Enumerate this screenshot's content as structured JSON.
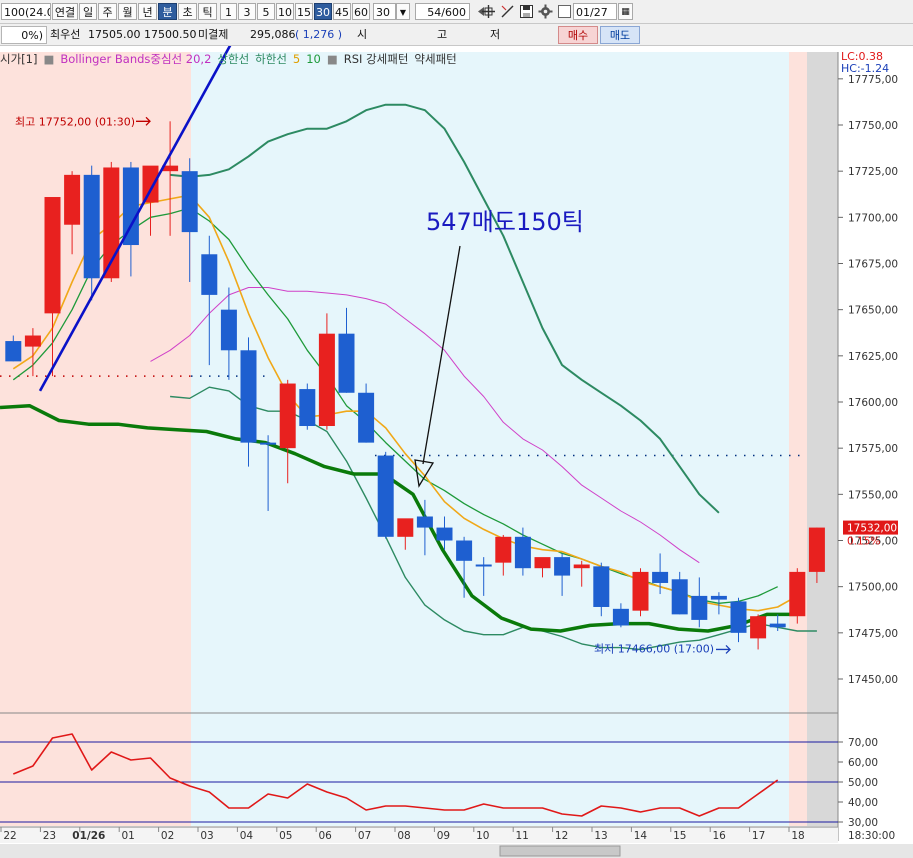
{
  "toolbar": {
    "code_field": "100(24.0",
    "periods": [
      "연결",
      "일",
      "주",
      "월",
      "년",
      "분",
      "초",
      "틱"
    ],
    "active_period": "분",
    "intervals": [
      "1",
      "3",
      "5",
      "10",
      "15",
      "30",
      "45",
      "60"
    ],
    "active_interval": "30",
    "interval_select": "30",
    "count_field": "54/600",
    "date_field": "01/27"
  },
  "quote_bar": {
    "pct": "0%)",
    "best_bid_label": "최우선",
    "best_bid_values": "17505.00  17500.50",
    "open_interest_label": "미결제",
    "open_interest_value": "295,086",
    "open_interest_change": "( 1,276 )",
    "col_open": "시",
    "col_high": "고",
    "col_low": "저",
    "buy_button": "매수",
    "sell_button": "매도"
  },
  "legend": {
    "series": "시가[1]",
    "bollinger_mid": "Bollinger Bands중심선 20,2",
    "bollinger_upper": "상한선",
    "bollinger_lower": "하한선",
    "ma1": "5",
    "ma2": "10",
    "rsi_strong": "RSI 강세패턴",
    "rsi_weak": "약세패턴",
    "lc": "LC:0.38",
    "hc": "HC:-1.24"
  },
  "colors": {
    "bull": "#e8211f",
    "bear": "#1e5fd0",
    "bg_pre_session": "#fde2dc",
    "bg_session": "#e6f6fb",
    "bb_upper_lower": "#2d8a62",
    "ma5": "#f0a818",
    "ma10": "#1e9a3a",
    "bb_mid": "#d040c8",
    "ichimoku_thick": "#0a7a0a",
    "rsi_line": "#e01818",
    "trend_line": "#0a12c8",
    "annotation": "#1a1ac0"
  },
  "chart_data": {
    "type": "candlestick",
    "interval_minutes": 30,
    "ylim": [
      17430,
      17785
    ],
    "price_axis_ticks": [
      "17775,00",
      "17750,00",
      "17725,00",
      "17700,00",
      "17675,00",
      "17650,00",
      "17625,00",
      "17600,00",
      "17575,00",
      "17550,00",
      "17525,00",
      "17500,00",
      "17475,00",
      "17450,00"
    ],
    "price_tick_values": [
      17775,
      17750,
      17725,
      17700,
      17675,
      17650,
      17625,
      17600,
      17575,
      17550,
      17525,
      17500,
      17475,
      17450
    ],
    "time_axis_labels": [
      "22",
      "23",
      "01/26",
      "01",
      "02",
      "03",
      "04",
      "05",
      "06",
      "07",
      "08",
      "09",
      "10",
      "11",
      "12",
      "13",
      "14",
      "15",
      "16",
      "17",
      "18"
    ],
    "last_price_label": "17532,00",
    "last_change_label": "0.15%",
    "high_annotation": "최고 17752,00 (01:30)",
    "low_annotation": "최저 17466,00 (17:00)",
    "custom_annotation": "547매도150틱",
    "candles": [
      {
        "o": 17633,
        "h": 17636,
        "l": 17622,
        "c": 17622
      },
      {
        "o": 17630,
        "h": 17640,
        "l": 17614,
        "c": 17636
      },
      {
        "o": 17648,
        "h": 17660,
        "l": 17614,
        "c": 17711
      },
      {
        "o": 17696,
        "h": 17725,
        "l": 17680,
        "c": 17723
      },
      {
        "o": 17723,
        "h": 17728,
        "l": 17655,
        "c": 17667
      },
      {
        "o": 17667,
        "h": 17730,
        "l": 17665,
        "c": 17727
      },
      {
        "o": 17727,
        "h": 17730,
        "l": 17668,
        "c": 17685
      },
      {
        "o": 17708,
        "h": 17715,
        "l": 17690,
        "c": 17728
      },
      {
        "o": 17725,
        "h": 17752,
        "l": 17690,
        "c": 17728
      },
      {
        "o": 17725,
        "h": 17732,
        "l": 17665,
        "c": 17692
      },
      {
        "o": 17680,
        "h": 17690,
        "l": 17620,
        "c": 17658
      },
      {
        "o": 17650,
        "h": 17662,
        "l": 17612,
        "c": 17628
      },
      {
        "o": 17628,
        "h": 17635,
        "l": 17565,
        "c": 17578
      },
      {
        "o": 17578,
        "h": 17582,
        "l": 17541,
        "c": 17577
      },
      {
        "o": 17575,
        "h": 17612,
        "l": 17556,
        "c": 17610
      },
      {
        "o": 17607,
        "h": 17610,
        "l": 17585,
        "c": 17587
      },
      {
        "o": 17587,
        "h": 17648,
        "l": 17585,
        "c": 17637
      },
      {
        "o": 17637,
        "h": 17651,
        "l": 17605,
        "c": 17605
      },
      {
        "o": 17605,
        "h": 17610,
        "l": 17578,
        "c": 17578
      },
      {
        "o": 17571,
        "h": 17573,
        "l": 17526,
        "c": 17527
      },
      {
        "o": 17527,
        "h": 17535,
        "l": 17520,
        "c": 17537
      },
      {
        "o": 17538,
        "h": 17547,
        "l": 17517,
        "c": 17532
      },
      {
        "o": 17532,
        "h": 17538,
        "l": 17520,
        "c": 17525
      },
      {
        "o": 17525,
        "h": 17527,
        "l": 17494,
        "c": 17514
      },
      {
        "o": 17512,
        "h": 17516,
        "l": 17495,
        "c": 17511
      },
      {
        "o": 17513,
        "h": 17528,
        "l": 17506,
        "c": 17527
      },
      {
        "o": 17527,
        "h": 17532,
        "l": 17506,
        "c": 17510
      },
      {
        "o": 17510,
        "h": 17515,
        "l": 17505,
        "c": 17516
      },
      {
        "o": 17516,
        "h": 17518,
        "l": 17495,
        "c": 17506
      },
      {
        "o": 17510,
        "h": 17514,
        "l": 17500,
        "c": 17512
      },
      {
        "o": 17511,
        "h": 17513,
        "l": 17484,
        "c": 17489
      },
      {
        "o": 17488,
        "h": 17491,
        "l": 17478,
        "c": 17479
      },
      {
        "o": 17487,
        "h": 17510,
        "l": 17484,
        "c": 17508
      },
      {
        "o": 17508,
        "h": 17518,
        "l": 17496,
        "c": 17502
      },
      {
        "o": 17504,
        "h": 17508,
        "l": 17485,
        "c": 17485
      },
      {
        "o": 17495,
        "h": 17505,
        "l": 17478,
        "c": 17482
      },
      {
        "o": 17495,
        "h": 17497,
        "l": 17485,
        "c": 17493
      },
      {
        "o": 17492,
        "h": 17494,
        "l": 17470,
        "c": 17475
      },
      {
        "o": 17472,
        "h": 17485,
        "l": 17466,
        "c": 17484
      },
      {
        "o": 17480,
        "h": 17485,
        "l": 17476,
        "c": 17478
      },
      {
        "o": 17484,
        "h": 17510,
        "l": 17480,
        "c": 17508
      },
      {
        "o": 17508,
        "h": 17532,
        "l": 17502,
        "c": 17532
      }
    ],
    "bb_upper": [
      null,
      null,
      null,
      null,
      null,
      null,
      null,
      null,
      17723,
      17722,
      17723,
      17726,
      17733,
      17741,
      17745,
      17748,
      17748,
      17752,
      17758,
      17761,
      17761,
      17758,
      17748,
      17730,
      17710,
      17690,
      17665,
      17640,
      17620,
      17612,
      17605,
      17598,
      17590,
      17580,
      17565,
      17550,
      17540
    ],
    "bb_lower": [
      null,
      null,
      null,
      null,
      null,
      null,
      null,
      null,
      17603,
      17602,
      17608,
      17606,
      17598,
      17595,
      17595,
      17590,
      17584,
      17568,
      17548,
      17527,
      17505,
      17490,
      17482,
      17476,
      17474,
      17474,
      17478,
      17476,
      17473,
      17469,
      17467,
      17467,
      17466,
      17468,
      17470,
      17471,
      17474,
      17477,
      17480,
      17478,
      17476,
      17476
    ],
    "bb_mid": [
      17622,
      17628,
      17636,
      17648,
      17658,
      17662,
      17662,
      17660,
      17660,
      17659,
      17658,
      17656,
      17653,
      17645,
      17637,
      17628,
      17614,
      17603,
      17589,
      17580,
      17574,
      17565,
      17555,
      17548,
      17541,
      17535,
      17528,
      17520,
      17513
    ],
    "ma5": [
      17618,
      17625,
      17640,
      17665,
      17688,
      17696,
      17706,
      17708,
      17710,
      17712,
      17700,
      17676,
      17648,
      17624,
      17604,
      17592,
      17593,
      17595,
      17595,
      17586,
      17572,
      17560,
      17546,
      17537,
      17531,
      17526,
      17522,
      17520,
      17519,
      17515,
      17511,
      17508,
      17503,
      17500,
      17497,
      17492,
      17490,
      17488,
      17487,
      17489,
      17495
    ],
    "ma10": [
      17612,
      17620,
      17632,
      17650,
      17672,
      17685,
      17693,
      17700,
      17702,
      17705,
      17698,
      17688,
      17672,
      17658,
      17645,
      17628,
      17614,
      17598,
      17589,
      17578,
      17568,
      17558,
      17552,
      17545,
      17539,
      17534,
      17528,
      17523,
      17518,
      17515,
      17511,
      17507,
      17504,
      17500,
      17497,
      17493,
      17491,
      17492,
      17495,
      17500
    ],
    "ichimoku": [
      17597,
      17598,
      17590,
      17588,
      17588,
      17586,
      17585,
      17584,
      17580,
      17578,
      17572,
      17565,
      17561,
      17561,
      17550,
      17520,
      17495,
      17483,
      17477,
      17476,
      17479,
      17480,
      17480,
      17477,
      17476,
      17479,
      17485,
      17485
    ],
    "rsi_levels": [
      70,
      60,
      50,
      40,
      30
    ],
    "rsi_ticks": [
      "70,00",
      "60,00",
      "50,00",
      "40,00",
      "30,00"
    ],
    "rsi": [
      54,
      58,
      72,
      74,
      56,
      65,
      61,
      62,
      52,
      48,
      45,
      37,
      37,
      44,
      42,
      49,
      45,
      42,
      36,
      38,
      38,
      37,
      36,
      36,
      39,
      37,
      37,
      37,
      34,
      33,
      38,
      37,
      35,
      37,
      37,
      33,
      37,
      37,
      44,
      51
    ],
    "clock_label": "18:30:00"
  }
}
